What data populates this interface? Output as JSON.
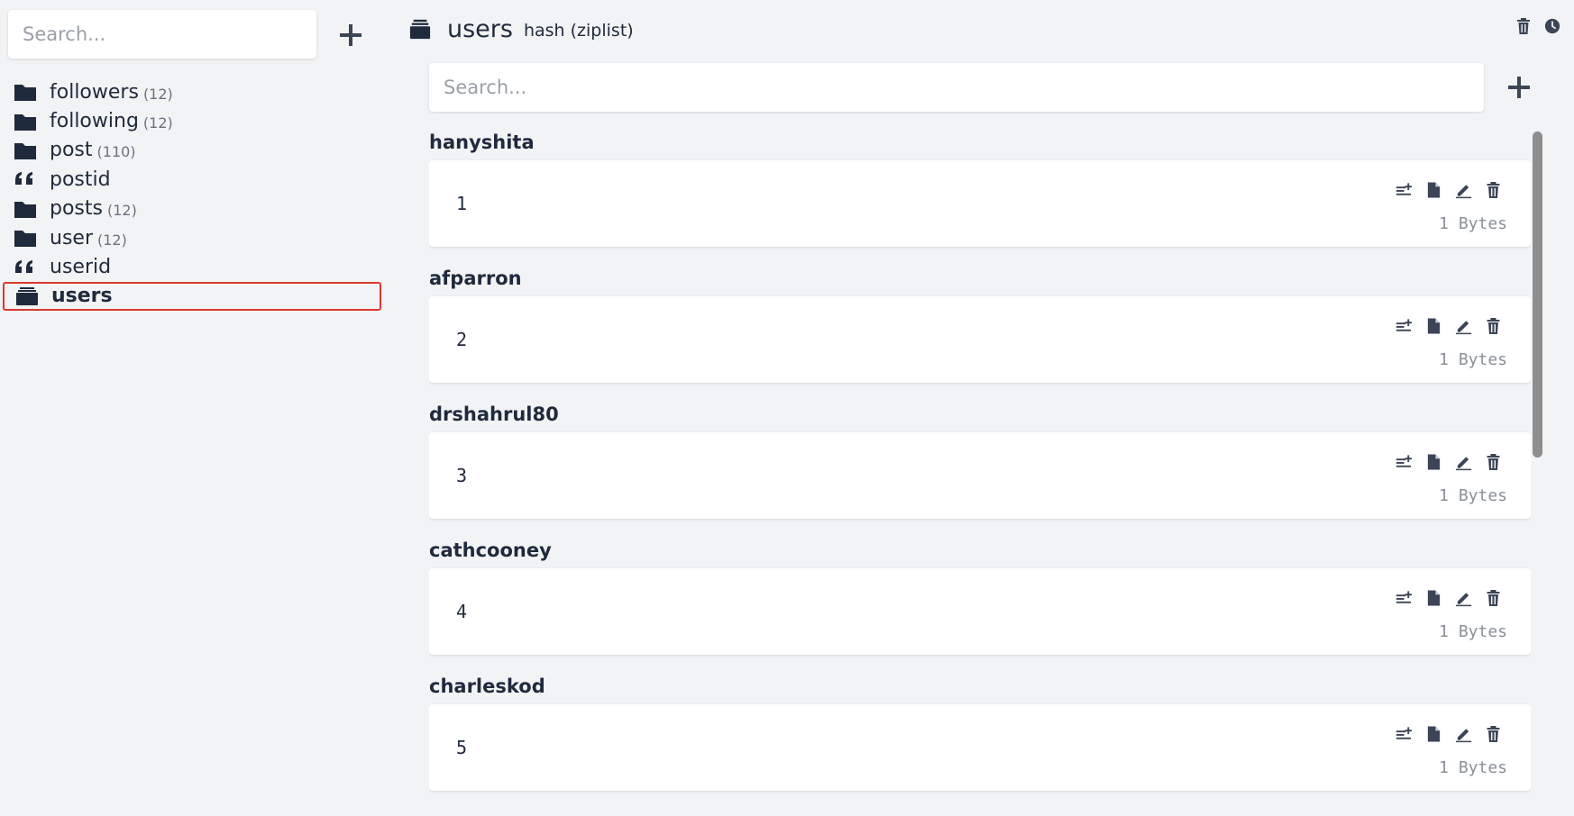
{
  "sidebar": {
    "search_placeholder": "Search...",
    "keys": [
      {
        "name": "followers",
        "count": "(12)",
        "icon": "folder-icon"
      },
      {
        "name": "following",
        "count": "(12)",
        "icon": "folder-icon"
      },
      {
        "name": "post",
        "count": "(110)",
        "icon": "folder-icon"
      },
      {
        "name": "postid",
        "count": "",
        "icon": "quote-icon"
      },
      {
        "name": "posts",
        "count": "(12)",
        "icon": "folder-icon"
      },
      {
        "name": "user",
        "count": "(12)",
        "icon": "folder-icon"
      },
      {
        "name": "userid",
        "count": "",
        "icon": "quote-icon"
      },
      {
        "name": "users",
        "count": "",
        "icon": "archive-icon",
        "selected": true
      }
    ]
  },
  "header": {
    "title": "users",
    "type": "hash (ziplist)"
  },
  "main": {
    "search_placeholder": "Search..."
  },
  "fields": [
    {
      "name": "hanyshita",
      "value": "1",
      "size": "1 Bytes"
    },
    {
      "name": "afparron",
      "value": "2",
      "size": "1 Bytes"
    },
    {
      "name": "drshahrul80",
      "value": "3",
      "size": "1 Bytes"
    },
    {
      "name": "cathcooney",
      "value": "4",
      "size": "1 Bytes"
    },
    {
      "name": "charleskod",
      "value": "5",
      "size": "1 Bytes"
    }
  ],
  "colors": {
    "background": "#f2f3f5",
    "text": "#1f2a3c",
    "selection_border": "#d93a2e",
    "muted": "#8a9099"
  }
}
